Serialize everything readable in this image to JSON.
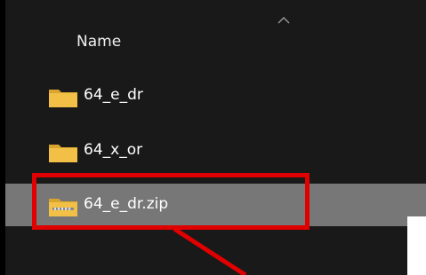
{
  "header": {
    "name_column": "Name",
    "sort_icon": "chevron-up-icon"
  },
  "files": [
    {
      "name": "64_e_dr",
      "icon": "folder-icon",
      "selected": false
    },
    {
      "name": "64_x_or",
      "icon": "folder-icon",
      "selected": false
    },
    {
      "name": "64_e_dr.zip",
      "icon": "zip-folder-icon",
      "selected": true
    }
  ],
  "annotation": {
    "color": "#e00000"
  },
  "colors": {
    "background": "#191919",
    "selection": "#777777",
    "folder": "#f2c046"
  }
}
